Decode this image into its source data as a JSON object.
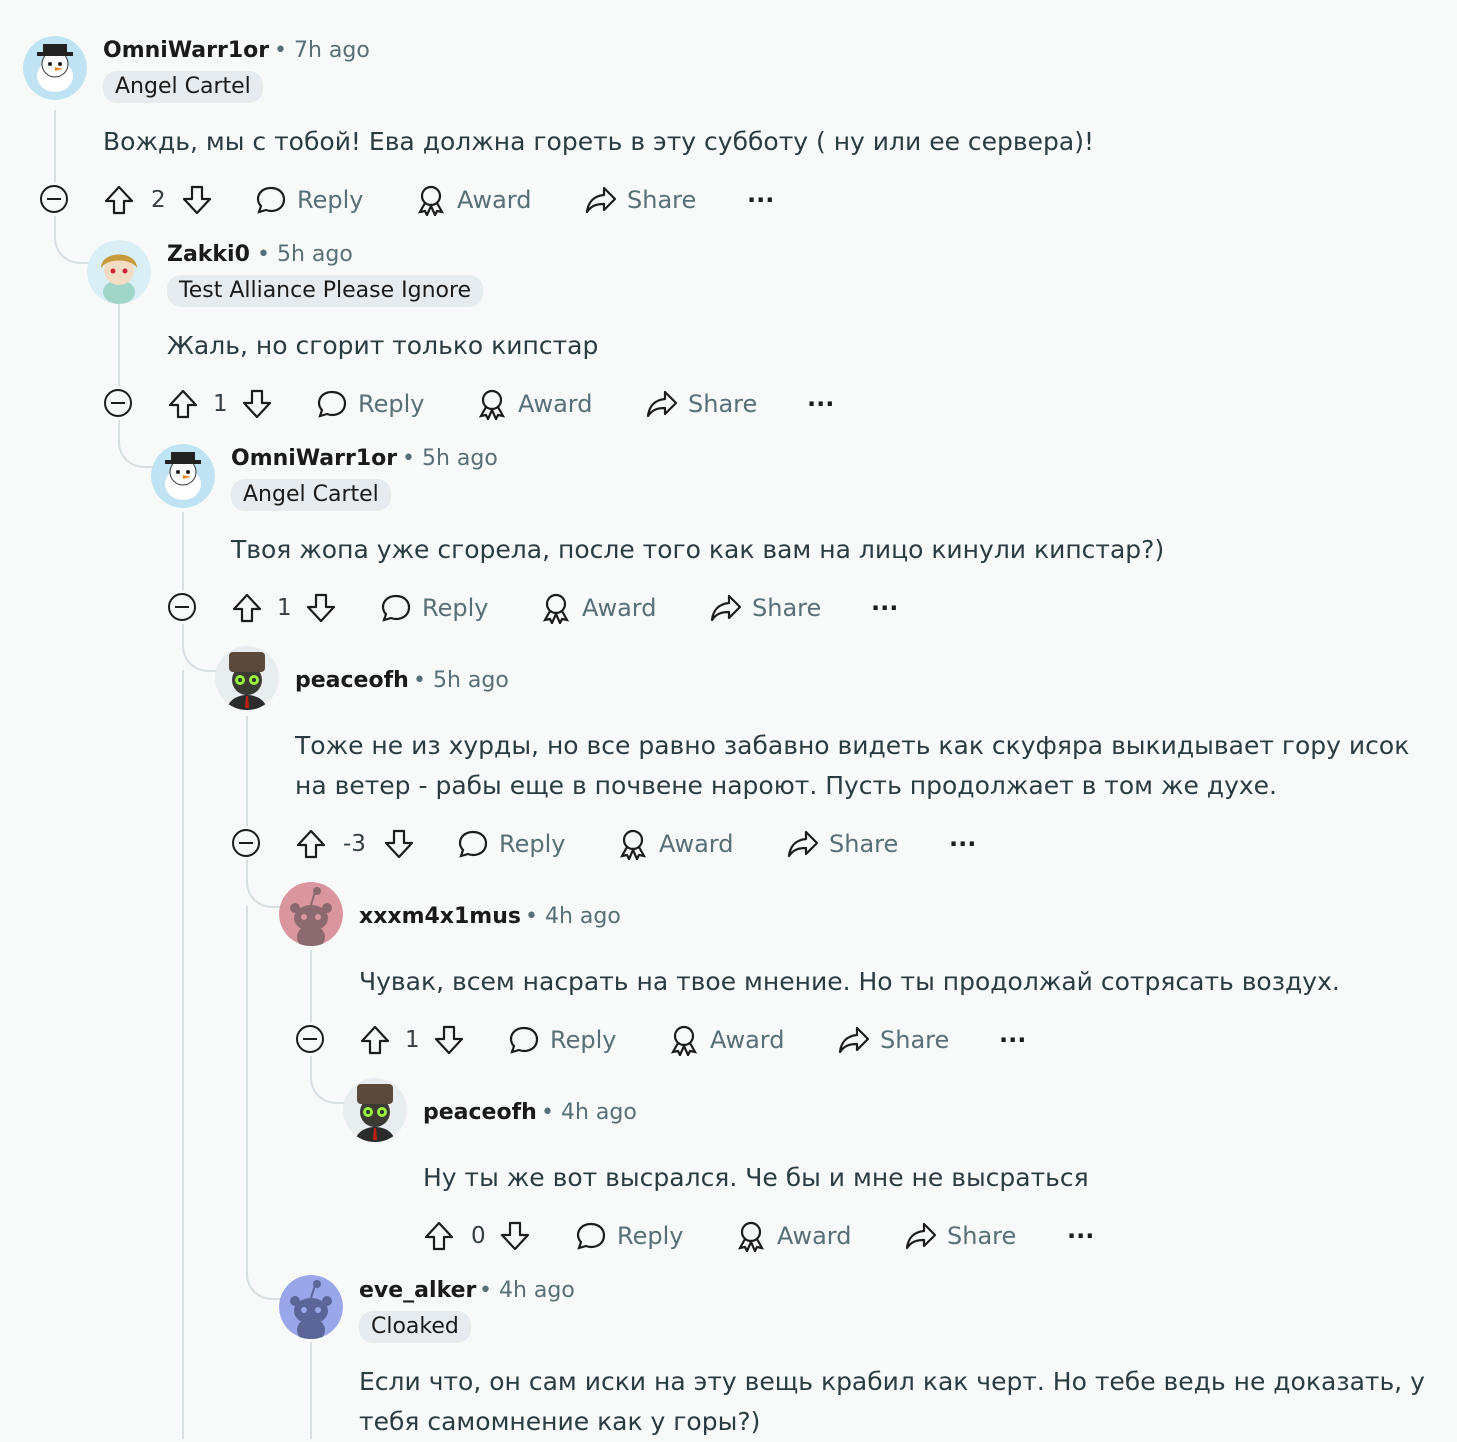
{
  "comments": [
    {
      "username": "OmniWarr1or",
      "time": "• 7h ago",
      "flair": "Angel Cartel",
      "body": "Вождь, мы с тобой! Ева должна гореть в эту субботу ( ну или ее сервера)!",
      "score": "2",
      "reply": "Reply",
      "award": "Award",
      "share": "Share",
      "more": "···",
      "avatar_color": "#bfe3f2"
    },
    {
      "username": "Zakki0",
      "time": "• 5h ago",
      "flair": "Test Alliance Please Ignore",
      "body": "Жаль, но сгорит только кипстар",
      "score": "1",
      "reply": "Reply",
      "award": "Award",
      "share": "Share",
      "more": "···",
      "avatar_color": "#d9eef5"
    },
    {
      "username": "OmniWarr1or",
      "time": "• 5h ago",
      "flair": "Angel Cartel",
      "body": "Твоя жопа уже сгорела, после того как вам на лицо кинули кипстар?)",
      "score": "1",
      "reply": "Reply",
      "award": "Award",
      "share": "Share",
      "more": "···",
      "avatar_color": "#bfe3f2"
    },
    {
      "username": "peaceofh",
      "time": "• 5h ago",
      "body": "Тоже не из хурды, но все равно забавно видеть как скуфяра выкидывает гору исок на ветер - рабы еще в почвене нароют. Пусть продолжает в том же духе.",
      "score": "-3",
      "reply": "Reply",
      "award": "Award",
      "share": "Share",
      "more": "···",
      "avatar_color": "#e8edef"
    },
    {
      "username": "xxxm4x1mus",
      "time": "• 4h ago",
      "body": "Чувак, всем насрать на твое мнение. Но ты продолжай сотрясать воздух.",
      "score": "1",
      "reply": "Reply",
      "award": "Award",
      "share": "Share",
      "more": "···",
      "avatar_color": "#d9969f"
    },
    {
      "username": "peaceofh",
      "time": "• 4h ago",
      "body": "Ну ты же вот высрался. Че бы и мне не высраться",
      "score": "0",
      "reply": "Reply",
      "award": "Award",
      "share": "Share",
      "more": "···",
      "avatar_color": "#e8edef"
    },
    {
      "username": "eve_alker",
      "time": "• 4h ago",
      "flair": "Cloaked",
      "body": "Если что, он сам иски на эту вещь крабил как черт. Но тебе ведь не доказать, у тебя самомнение как у горы?)",
      "avatar_color": "#9aa6ea"
    }
  ]
}
